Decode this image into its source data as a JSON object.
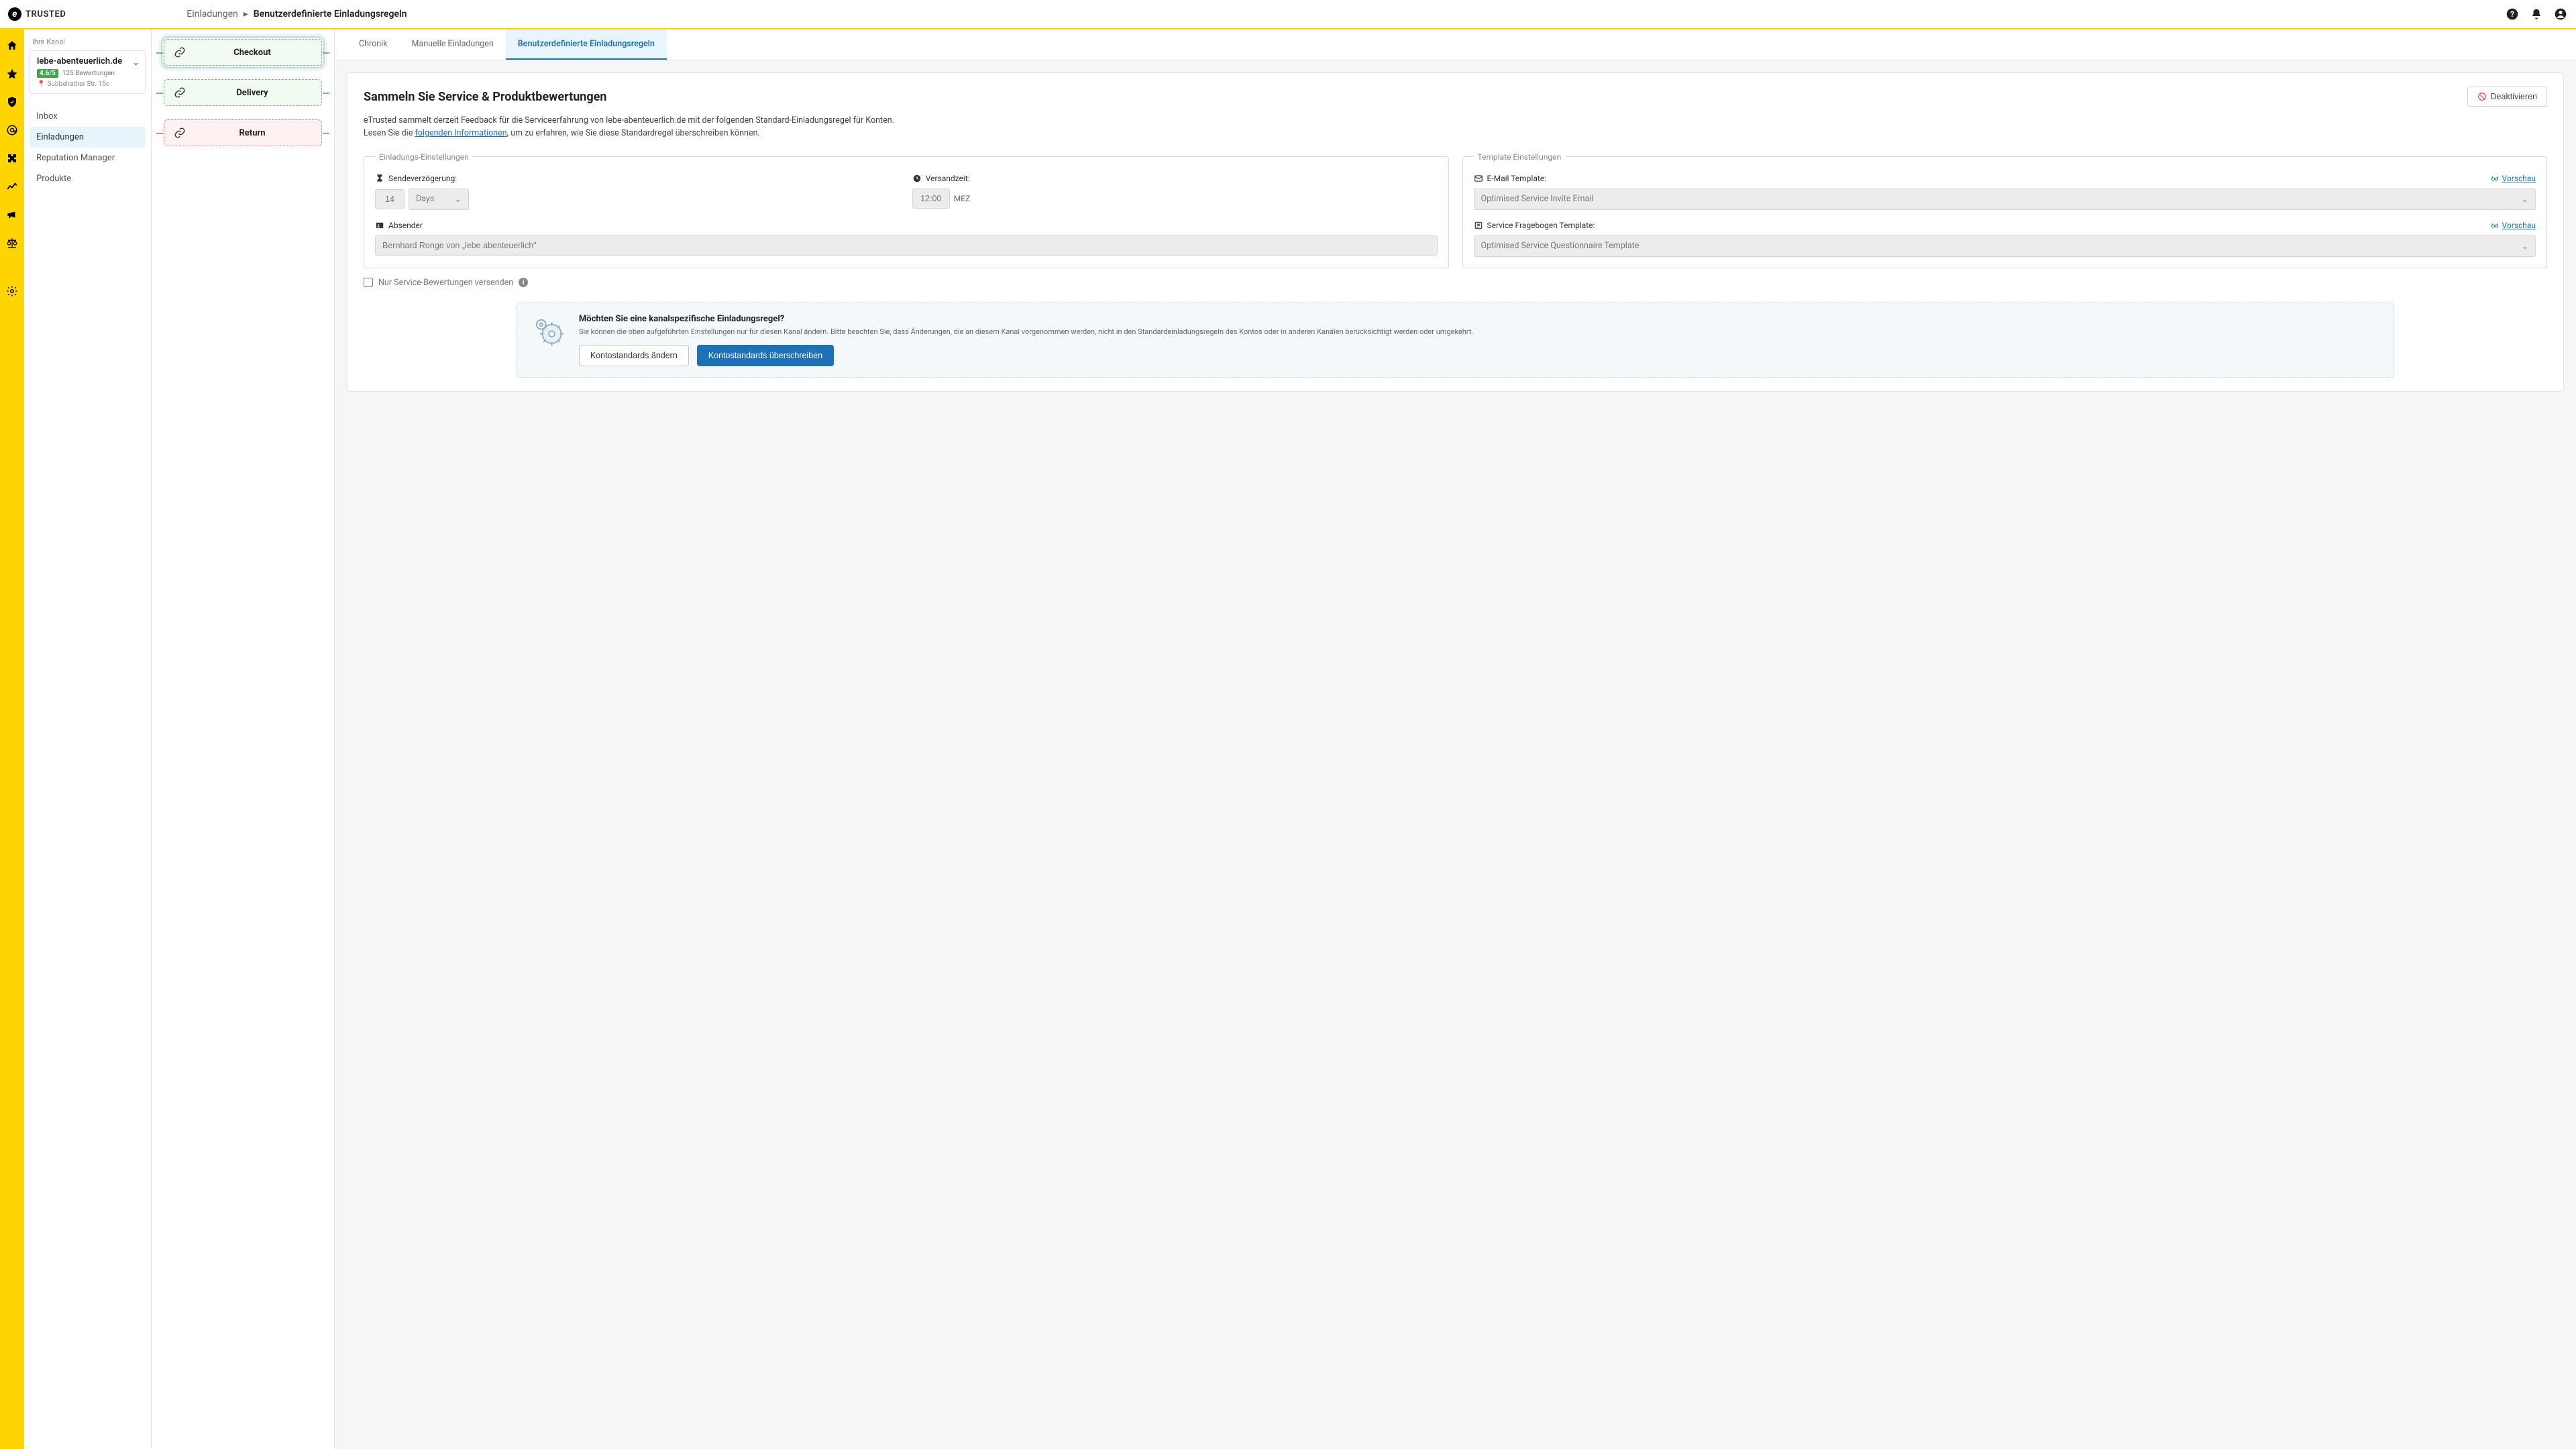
{
  "brand": "TRUSTED",
  "breadcrumb": {
    "parent": "Einladungen",
    "current": "Benutzerdefinierte Einladungsregeln"
  },
  "sidepanel": {
    "your_channel_label": "Ihre Kanal",
    "channel": {
      "name": "lebe-abenteuerlich.de",
      "rating": "4.6/5",
      "reviews": "125 Bewertungen",
      "address": "Subbelrather Str. 15c"
    },
    "nav": {
      "inbox": "Inbox",
      "invitations": "Einladungen",
      "reputation": "Reputation Manager",
      "products": "Produkte"
    }
  },
  "tabs": {
    "chronik": "Chronik",
    "manual": "Manuelle Einladungen",
    "custom": "Benutzerdefinierte Einladungsregeln"
  },
  "events": {
    "checkout": "Checkout",
    "delivery": "Delivery",
    "return": "Return"
  },
  "card": {
    "title": "Sammeln Sie Service & Produktbewertungen",
    "deactivate": "Deaktivieren",
    "desc_line1": "eTrusted sammelt derzeit Feedback für die Serviceerfahrung von lebe-abenteuerlich.de mit der folgenden Standard-Einladungsregel für Konten.",
    "desc_line2a": "Lesen Sie die ",
    "desc_link": "folgenden Informationen",
    "desc_line2b": ", um zu erfahren, wie Sie diese Standardregel überschreiben können."
  },
  "settings": {
    "legend_invite": "Einladungs-Einstellungen",
    "legend_template": "Template Einstellungen",
    "send_delay_label": "Sendeverzögerung:",
    "send_delay_value": "14",
    "send_delay_unit": "Days",
    "send_time_label": "Versandzeit:",
    "send_time_value": "12:00",
    "send_time_tz": "MEZ",
    "sender_label": "Absender",
    "sender_value": "Bernhard Ronge von „lebe abenteuerlich\"",
    "email_template_label": "E-Mail Template:",
    "email_template_value": "Optimised Service Invite Email",
    "service_template_label": "Service Fragebogen Template:",
    "service_template_value": "Optimised Service Questionnaire Template",
    "preview": "Vorschau",
    "only_service_label": "Nur Service-Bewertungen versenden"
  },
  "callout": {
    "title": "Möchten Sie eine kanalspezifische Einladungsregel?",
    "body": "Sie können die oben aufgeführten Einstellungen nur für diesen Kanal ändern. Bitte beachten Sie, dass Änderungen, die an diesem Kanal vorgenommen werden, nicht in den Standardeinladungsregeln des Kontos oder in anderen Kanälen berücksichtigt werden oder umgekehrt.",
    "btn_edit": "Kontostandards ändern",
    "btn_override": "Kontostandards überschreiben"
  }
}
